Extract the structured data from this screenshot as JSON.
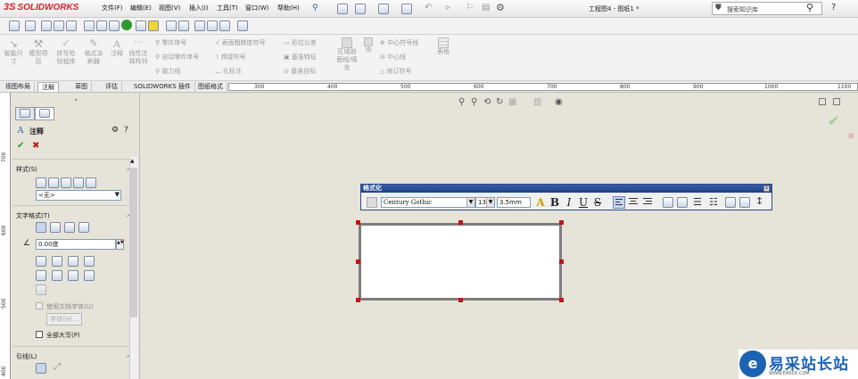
{
  "app": {
    "brand": "SOLIDWORKS",
    "brand_prefix": "3S",
    "doc_title": "工程图4 - 图纸1 *"
  },
  "menu": [
    "文件(F)",
    "编辑(E)",
    "视图(V)",
    "插入(I)",
    "工具(T)",
    "窗口(W)",
    "帮助(H)"
  ],
  "search": {
    "placeholder": "搜索知识库"
  },
  "title_icons": [
    "pin-icon",
    "new-icon",
    "open-icon",
    "save-icon",
    "print-icon",
    "undo-icon",
    "select-icon",
    "rebuild-icon",
    "options-icon",
    "help-icon",
    "search-icon"
  ],
  "ribbon": {
    "big_buttons": [
      {
        "label": "智能尺\n寸",
        "icon": "smart-dimension-icon"
      },
      {
        "label": "模型项\n目",
        "icon": "model-items-icon"
      },
      {
        "label": "拼写检\n验程序",
        "icon": "spell-check-icon"
      },
      {
        "label": "格式涂\n刷器",
        "icon": "format-painter-icon"
      },
      {
        "label": "注释",
        "icon": "note-icon"
      },
      {
        "label": "线性注\n释阵列",
        "icon": "linear-note-pattern-icon"
      }
    ],
    "small_items": [
      {
        "label": "零件序号",
        "icon": "balloon-icon"
      },
      {
        "label": "自动零件序号",
        "icon": "auto-balloon-icon"
      },
      {
        "label": "磁力线",
        "icon": "magnetic-line-icon"
      },
      {
        "label": "表面粗糙度符号",
        "icon": "surface-finish-icon"
      },
      {
        "label": "焊接符号",
        "icon": "weld-symbol-icon"
      },
      {
        "label": "孔标注",
        "icon": "hole-callout-icon"
      },
      {
        "label": "形位公差",
        "icon": "geometric-tolerance-icon"
      },
      {
        "label": "基准特征",
        "icon": "datum-feature-icon"
      },
      {
        "label": "基准目标",
        "icon": "datum-target-icon"
      },
      {
        "label": "区域剖\n面线/填\n充",
        "icon": "area-hatch-icon"
      },
      {
        "label": "块",
        "icon": "block-icon"
      },
      {
        "label": "中心符号线",
        "icon": "center-mark-icon"
      },
      {
        "label": "中心线",
        "icon": "centerline-icon"
      },
      {
        "label": "修订符号",
        "icon": "revision-symbol-icon"
      },
      {
        "label": "表格",
        "icon": "table-icon"
      }
    ]
  },
  "tabs": [
    "视图布局",
    "注解",
    "草图",
    "评估",
    "SOLIDWORKS 插件",
    "图纸格式"
  ],
  "active_tab": "注解",
  "ruler": {
    "h_labels": [
      "300",
      "400",
      "500",
      "600",
      "700",
      "800",
      "900",
      "1000",
      "1100"
    ],
    "v_labels": [
      "700",
      "600",
      "500",
      "400"
    ]
  },
  "property_manager": {
    "title": "注释",
    "sections": {
      "style": {
        "label": "样式(S)",
        "dropdown_value": "<无>"
      },
      "text_format": {
        "label": "文字格式(T)",
        "angle_value": "0.00度",
        "use_doc_font": "使用文档字体(U)",
        "font_button": "字体(H)...",
        "all_caps": "全部大写(P)"
      },
      "leader": {
        "label": "引线(L)"
      }
    }
  },
  "format_window": {
    "title": "格式化",
    "font": "Century Gothic",
    "size": "13",
    "height": "3.5mm",
    "buttons": {
      "A": "A",
      "bold": "B",
      "italic": "I",
      "underline": "U",
      "strike": "S"
    }
  },
  "watermark": {
    "text": "易采站长站",
    "sub": "WWW.EASCK.COM"
  },
  "colors": {
    "brand_red": "#d2232a",
    "titlebar_blue": "#1d3f84",
    "handle_red": "#c41515",
    "accent_green": "#2e9a2e"
  }
}
